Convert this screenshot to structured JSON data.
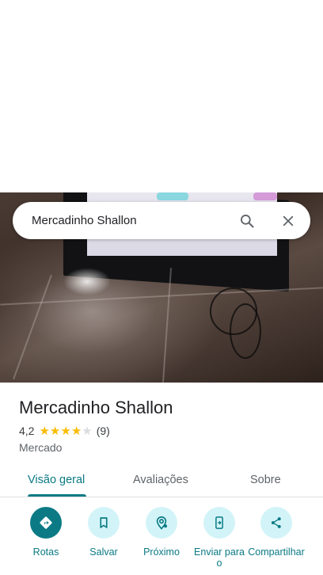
{
  "search": {
    "query": "Mercadinho Shallon"
  },
  "place": {
    "name": "Mercadinho Shallon",
    "rating": "4,2",
    "rating_value": 4.2,
    "stars_filled": 4,
    "stars_total": 5,
    "review_count": "(9)",
    "category": "Mercado"
  },
  "tabs": [
    {
      "label": "Visão geral",
      "active": true
    },
    {
      "label": "Avaliações",
      "active": false
    },
    {
      "label": "Sobre",
      "active": false
    }
  ],
  "actions": [
    {
      "label": "Rotas",
      "icon": "directions-icon"
    },
    {
      "label": "Salvar",
      "icon": "bookmark-icon"
    },
    {
      "label": "Próximo",
      "icon": "nearby-icon"
    },
    {
      "label": "Enviar para o",
      "icon": "send-to-phone-icon"
    },
    {
      "label": "Compartilhar",
      "icon": "share-icon"
    }
  ],
  "colors": {
    "accent": "#0b7a85",
    "action_bg": "#d2f4f8",
    "star": "#fbbc04"
  }
}
